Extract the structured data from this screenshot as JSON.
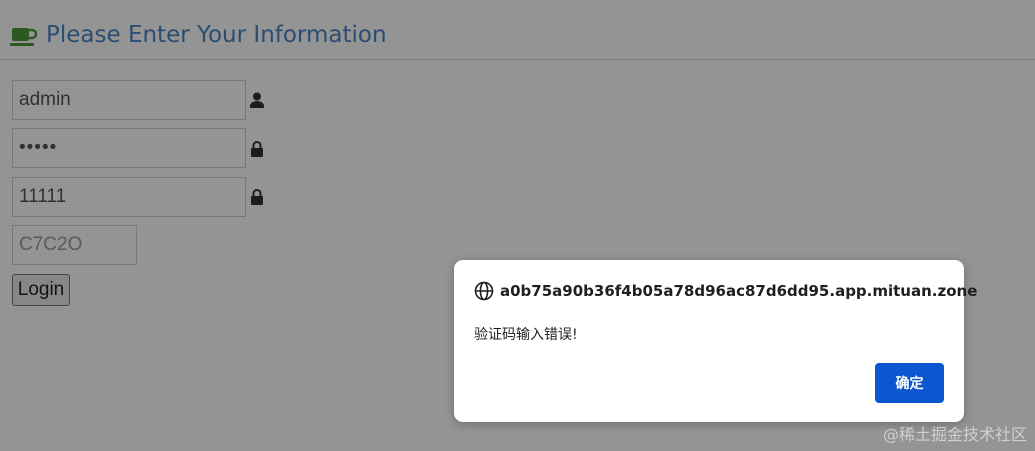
{
  "header": {
    "title": "Please Enter Your Information",
    "icon": "coffee-cup-icon",
    "title_color": "#4a86c5"
  },
  "form": {
    "username_value": "admin",
    "password_value": "•••••",
    "code_value": "11111",
    "captcha_text": "C7C2O",
    "login_label": "Login",
    "icons": {
      "username": "user-icon",
      "password": "lock-icon",
      "code": "lock-icon"
    }
  },
  "dialog": {
    "origin": "a0b75a90b36f4b05a78d96ac87d6dd95.app.mituan.zone",
    "message": "验证码输入错误!",
    "ok_label": "确定",
    "ok_color": "#0b57d0",
    "icon": "globe-icon"
  },
  "watermark": {
    "text": "@稀土掘金技术社区"
  }
}
